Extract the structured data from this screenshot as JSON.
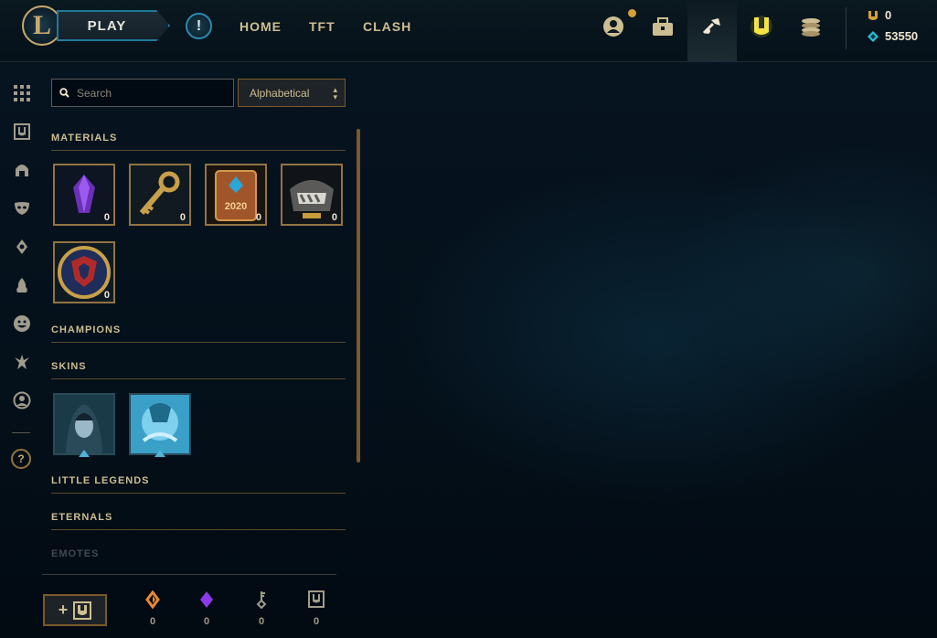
{
  "top": {
    "play_label": "PLAY",
    "alert_symbol": "!",
    "nav": [
      "HOME",
      "TFT",
      "CLASH"
    ],
    "icons": [
      "profile-icon",
      "collection-icon",
      "crafting-icon",
      "loot-icon",
      "store-icon"
    ],
    "currency": {
      "orange_essence": "0",
      "blue_essence": "53550"
    }
  },
  "rail": {
    "icons": [
      "all-items-icon",
      "chest-icon",
      "champion-helmet-icon",
      "mask-icon",
      "ward-icon",
      "fire-icon",
      "emote-icon",
      "little-legend-icon",
      "icon-profile-icon"
    ],
    "help_label": "?"
  },
  "search": {
    "placeholder": "Search"
  },
  "sort": {
    "selected": "Alphabetical"
  },
  "sections": {
    "materials": "MATERIALS",
    "champions": "CHAMPIONS",
    "skins": "SKINS",
    "little_legends": "LITTLE LEGENDS",
    "eternals": "ETERNALS",
    "emotes": "EMOTES"
  },
  "materials": [
    {
      "name": "mythic-essence",
      "count": "0"
    },
    {
      "name": "hextech-key",
      "count": "0"
    },
    {
      "name": "2020-event-pass-token",
      "count": "0"
    },
    {
      "name": "masterwork-chest",
      "count": "0"
    },
    {
      "name": "worlds-emblem-orb",
      "count": "0"
    }
  ],
  "skins": [
    {
      "name": "skin-shard-1"
    },
    {
      "name": "skin-shard-2"
    }
  ],
  "bottom": {
    "add_label": "+",
    "counts": [
      "0",
      "0",
      "0",
      "0"
    ]
  },
  "colors": {
    "gold": "#c8aa6e",
    "gold_dark": "#785a28",
    "blue_accent": "#1e7a9a",
    "background": "#020b13"
  }
}
